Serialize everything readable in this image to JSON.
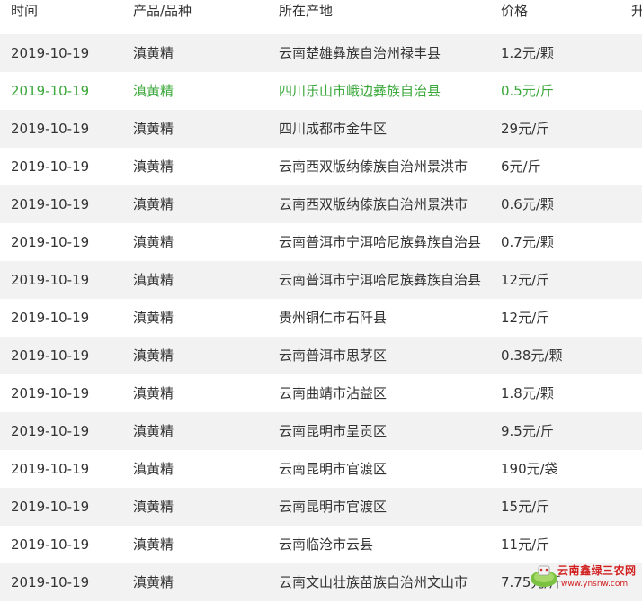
{
  "header": {
    "time": "时间",
    "product": "产品/品种",
    "origin": "所在产地",
    "price": "价格",
    "extra": "升"
  },
  "rows": [
    {
      "time": "2019-10-19",
      "product": "滇黄精",
      "origin": "云南楚雄彝族自治州禄丰县",
      "price": "1.2元/颗"
    },
    {
      "time": "2019-10-19",
      "product": "滇黄精",
      "origin": "四川乐山市峨边彝族自治县",
      "price": "0.5元/斤",
      "highlight": true
    },
    {
      "time": "2019-10-19",
      "product": "滇黄精",
      "origin": "四川成都市金牛区",
      "price": "29元/斤"
    },
    {
      "time": "2019-10-19",
      "product": "滇黄精",
      "origin": "云南西双版纳傣族自治州景洪市",
      "price": "6元/斤"
    },
    {
      "time": "2019-10-19",
      "product": "滇黄精",
      "origin": "云南西双版纳傣族自治州景洪市",
      "price": "0.6元/颗"
    },
    {
      "time": "2019-10-19",
      "product": "滇黄精",
      "origin": "云南普洱市宁洱哈尼族彝族自治县",
      "price": "0.7元/颗"
    },
    {
      "time": "2019-10-19",
      "product": "滇黄精",
      "origin": "云南普洱市宁洱哈尼族彝族自治县",
      "price": "12元/斤"
    },
    {
      "time": "2019-10-19",
      "product": "滇黄精",
      "origin": "贵州铜仁市石阡县",
      "price": "12元/斤"
    },
    {
      "time": "2019-10-19",
      "product": "滇黄精",
      "origin": "云南普洱市思茅区",
      "price": "0.38元/颗"
    },
    {
      "time": "2019-10-19",
      "product": "滇黄精",
      "origin": "云南曲靖市沾益区",
      "price": "1.8元/颗"
    },
    {
      "time": "2019-10-19",
      "product": "滇黄精",
      "origin": "云南昆明市呈贡区",
      "price": "9.5元/斤"
    },
    {
      "time": "2019-10-19",
      "product": "滇黄精",
      "origin": "云南昆明市官渡区",
      "price": "190元/袋"
    },
    {
      "time": "2019-10-19",
      "product": "滇黄精",
      "origin": "云南昆明市官渡区",
      "price": "15元/斤"
    },
    {
      "time": "2019-10-19",
      "product": "滇黄精",
      "origin": "云南临沧市云县",
      "price": "11元/斤"
    },
    {
      "time": "2019-10-19",
      "product": "滇黄精",
      "origin": "云南文山壮族苗族自治州文山市",
      "price": "7.75元/斤"
    }
  ],
  "watermark": {
    "name": "云南鑫绿三农网",
    "url": "www.ynsnw.com"
  },
  "colors": {
    "row_alt": "#f2f2f2",
    "highlight_text": "#3aa83a",
    "watermark": "#d21f1f"
  }
}
